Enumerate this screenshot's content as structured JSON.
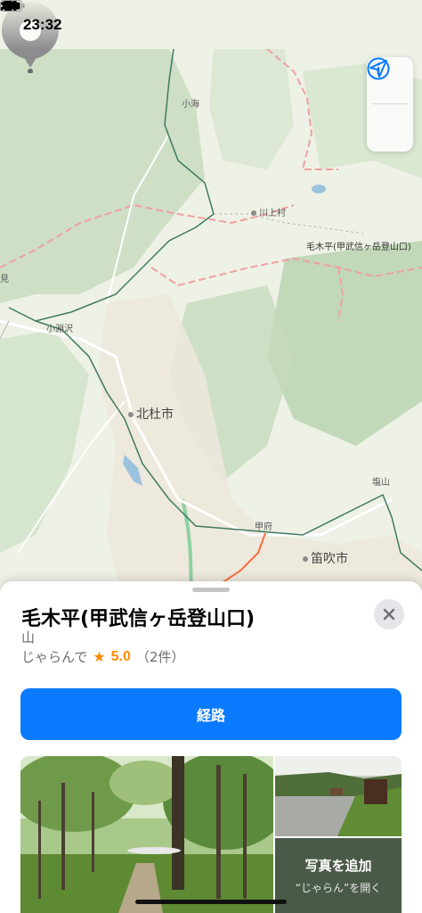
{
  "status_bar": {
    "time": "23:32"
  },
  "map": {
    "labels": {
      "komi": "小海",
      "kawakami": "川上村",
      "kobuchisawa": "小淵沢",
      "hokuto": "北杜市",
      "shioyama": "塩山",
      "kofu": "甲府",
      "fuefuki": "笛吹市",
      "mi": "見"
    },
    "pin_label": "毛木平(甲武信ヶ岳登山口)"
  },
  "sheet": {
    "title": "毛木平(甲武信ヶ岳登山口)",
    "category": "山",
    "rating_source": "じゃらんで",
    "rating_star": "★",
    "rating_value": "5.0",
    "rating_count": "（2件）",
    "route_button": "経路",
    "add_photo": "写真を追加",
    "add_photo_sub": "“じゃらん”を開く"
  },
  "colors": {
    "accent": "#0a7aff",
    "star": "#ff8a00"
  }
}
